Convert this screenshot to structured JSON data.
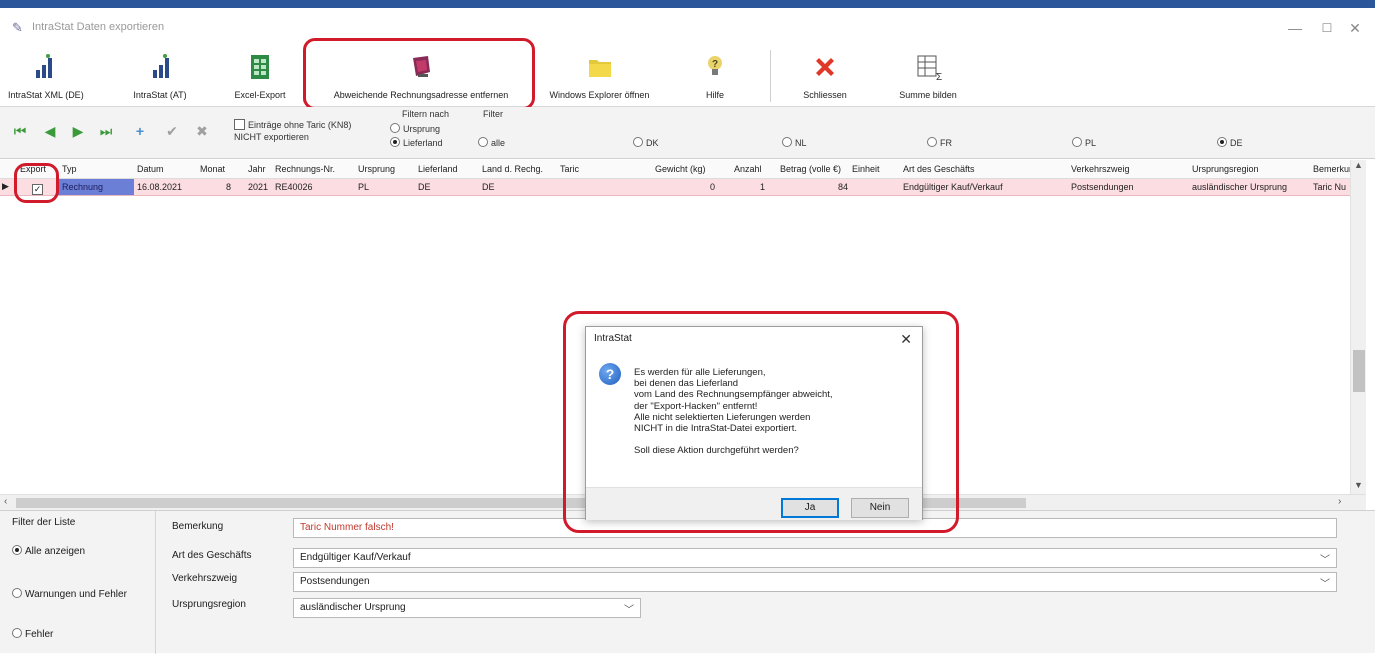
{
  "window": {
    "title": "IntraStat Daten exportieren",
    "min": "—",
    "max": "☐",
    "close": "✕"
  },
  "toolbar": {
    "intrastat_de": "IntraStat XML (DE)",
    "intrastat_at": "IntraStat (AT)",
    "excel_export": "Excel-Export",
    "abweichende": "Abweichende Rechnungsadresse entfernen",
    "explorer": "Windows Explorer öffnen",
    "hilfe": "Hilfe",
    "schliessen": "Schliessen",
    "summe": "Summe bilden"
  },
  "navbar": {
    "taric_line1": "Einträge ohne Taric (KN8)",
    "taric_line2": "NICHT exportieren",
    "filter_nach": "Filtern nach",
    "ursprung": "Ursprung",
    "lieferland": "Lieferland",
    "filter": "Filter",
    "opts": [
      "alle",
      "DK",
      "NL",
      "FR",
      "PL",
      "DE"
    ]
  },
  "grid": {
    "headers": [
      "Export",
      "Typ",
      "Datum",
      "Monat",
      "Jahr",
      "Rechnungs-Nr.",
      "Ursprung",
      "Lieferland",
      "Land d. Rechg.",
      "Taric",
      "Gewicht (kg)",
      "Anzahl",
      "Betrag (volle €)",
      "Einheit",
      "Art des Geschäfts",
      "Verkehrszweig",
      "Ursprungsregion",
      "Bemerkung"
    ],
    "row": {
      "typ": "Rechnung",
      "datum": "16.08.2021",
      "monat": "8",
      "jahr": "2021",
      "rnr": "RE40026",
      "ursprung": "PL",
      "lieferland": "DE",
      "land_rechg": "DE",
      "taric": "",
      "gewicht": "0",
      "anzahl": "1",
      "betrag": "84",
      "einheit": "",
      "art": "Endgültiger Kauf/Verkauf",
      "verkehr": "Postsendungen",
      "region": "ausländischer Ursprung",
      "bemerkung": "Taric Nu"
    }
  },
  "bottom": {
    "filter_title": "Filter der Liste",
    "alle": "Alle anzeigen",
    "warnungen": "Warnungen und Fehler",
    "fehler": "Fehler",
    "bemerkung_label": "Bemerkung",
    "bemerkung_value": "Taric Nummer falsch!",
    "art_label": "Art des Geschäfts",
    "art_value": "Endgültiger Kauf/Verkauf",
    "verkehr_label": "Verkehrszweig",
    "verkehr_value": "Postsendungen",
    "region_label": "Ursprungsregion",
    "region_value": "ausländischer Ursprung"
  },
  "dialog": {
    "title": "IntraStat",
    "lines": [
      "Es werden für alle Lieferungen,",
      "bei denen das Lieferland",
      "vom Land des Rechnungsempfänger abweicht,",
      "der \"Export-Hacken\" entfernt!",
      "Alle nicht selektierten Lieferungen werden",
      "NICHT in die IntraStat-Datei exportiert.",
      "",
      "Soll diese Aktion durchgeführt werden?"
    ],
    "ja": "Ja",
    "nein": "Nein"
  },
  "colors": {
    "accent": "#d11a2a",
    "row_highlight": "#fbdde2",
    "typ_cell": "#6b7fd6"
  }
}
